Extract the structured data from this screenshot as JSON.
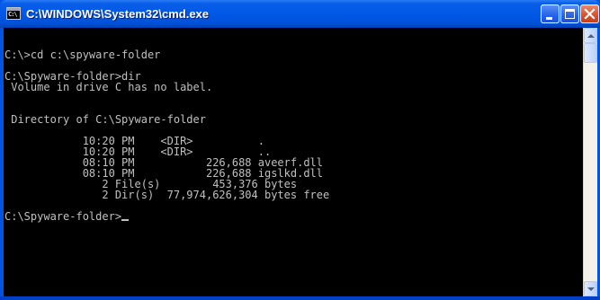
{
  "window": {
    "title": "C:\\WINDOWS\\System32\\cmd.exe",
    "icon": "cmd-app-icon",
    "icon_text": "C:\\"
  },
  "title_buttons": {
    "minimize": "minimize-icon",
    "maximize": "maximize-icon",
    "close": "close-icon"
  },
  "console": {
    "lines": [
      "",
      "C:\\>cd c:\\spyware-folder",
      "",
      "C:\\Spyware-folder>dir",
      " Volume in drive C has no label.",
      "",
      "",
      " Directory of C:\\Spyware-folder",
      "",
      "            10:20 PM    <DIR>          .",
      "            10:20 PM    <DIR>          ..",
      "            08:10 PM           226,688 aveerf.dll",
      "            08:10 PM           226,688 igslkd.dll",
      "               2 File(s)        453,376 bytes",
      "               2 Dir(s)  77,974,626,304 bytes free",
      "",
      "C:\\Spyware-folder>"
    ]
  },
  "colors": {
    "console_bg": "#000000",
    "console_fg": "#c0c0c0",
    "titlebar": "#0058e6"
  },
  "scrollbar": {
    "up_arrow": "scroll-up-icon",
    "down_arrow": "scroll-down-icon"
  }
}
